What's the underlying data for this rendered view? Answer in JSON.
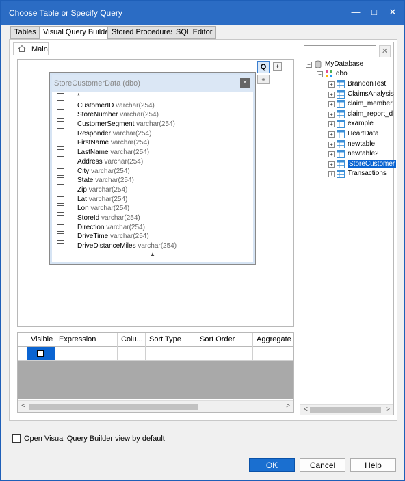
{
  "window": {
    "title": "Choose Table or Specify Query",
    "minimize": "—",
    "maximize": "□",
    "close": "✕"
  },
  "tabs": [
    {
      "label": "Tables",
      "active": false
    },
    {
      "label": "Visual Query Builder",
      "active": true
    },
    {
      "label": "Stored Procedures",
      "active": false
    },
    {
      "label": "SQL Editor",
      "active": false
    }
  ],
  "main_tab": {
    "label": "Main"
  },
  "builder": {
    "q_button": "Q",
    "plus_button": "+",
    "link_button": "⚭"
  },
  "table_box": {
    "title": "StoreCustomerData (dbo)",
    "close": "×",
    "scroll_arrow": "▲",
    "columns": [
      {
        "name": "*",
        "type": ""
      },
      {
        "name": "CustomerID",
        "type": "varchar(254)"
      },
      {
        "name": "StoreNumber",
        "type": "varchar(254)"
      },
      {
        "name": "CustomerSegment",
        "type": "varchar(254)"
      },
      {
        "name": "Responder",
        "type": "varchar(254)"
      },
      {
        "name": "FirstName",
        "type": "varchar(254)"
      },
      {
        "name": "LastName",
        "type": "varchar(254)"
      },
      {
        "name": "Address",
        "type": "varchar(254)"
      },
      {
        "name": "City",
        "type": "varchar(254)"
      },
      {
        "name": "State",
        "type": "varchar(254)"
      },
      {
        "name": "Zip",
        "type": "varchar(254)"
      },
      {
        "name": "Lat",
        "type": "varchar(254)"
      },
      {
        "name": "Lon",
        "type": "varchar(254)"
      },
      {
        "name": "StoreId",
        "type": "varchar(254)"
      },
      {
        "name": "Direction",
        "type": "varchar(254)"
      },
      {
        "name": "DriveTime",
        "type": "varchar(254)"
      },
      {
        "name": "DriveDistanceMiles",
        "type": "varchar(254)"
      }
    ]
  },
  "grid": {
    "headers": [
      "",
      "Visible",
      "Expression",
      "Colu...",
      "Sort Type",
      "Sort Order",
      "Aggregate"
    ],
    "left_arrow": "<",
    "right_arrow": ">"
  },
  "tree": {
    "search_placeholder": "",
    "clear": "✕",
    "root": "MyDatabase",
    "schema": "dbo",
    "tables": [
      {
        "name": "BrandonTest",
        "selected": false
      },
      {
        "name": "ClaimsAnalysis",
        "selected": false
      },
      {
        "name": "claim_member",
        "selected": false
      },
      {
        "name": "claim_report_d",
        "selected": false
      },
      {
        "name": "example",
        "selected": false
      },
      {
        "name": "HeartData",
        "selected": false
      },
      {
        "name": "newtable",
        "selected": false
      },
      {
        "name": "newtable2",
        "selected": false
      },
      {
        "name": "StoreCustomer",
        "selected": true
      },
      {
        "name": "Transactions",
        "selected": false
      }
    ],
    "left_arrow": "<",
    "right_arrow": ">"
  },
  "options": {
    "open_vqb_default": "Open Visual Query Builder view by default",
    "checked": false
  },
  "buttons": {
    "ok": "OK",
    "cancel": "Cancel",
    "help": "Help"
  },
  "colors": {
    "titlebar": "#2b6cc4",
    "selection": "#0a64d2",
    "primary_button": "#1a6fd0"
  }
}
